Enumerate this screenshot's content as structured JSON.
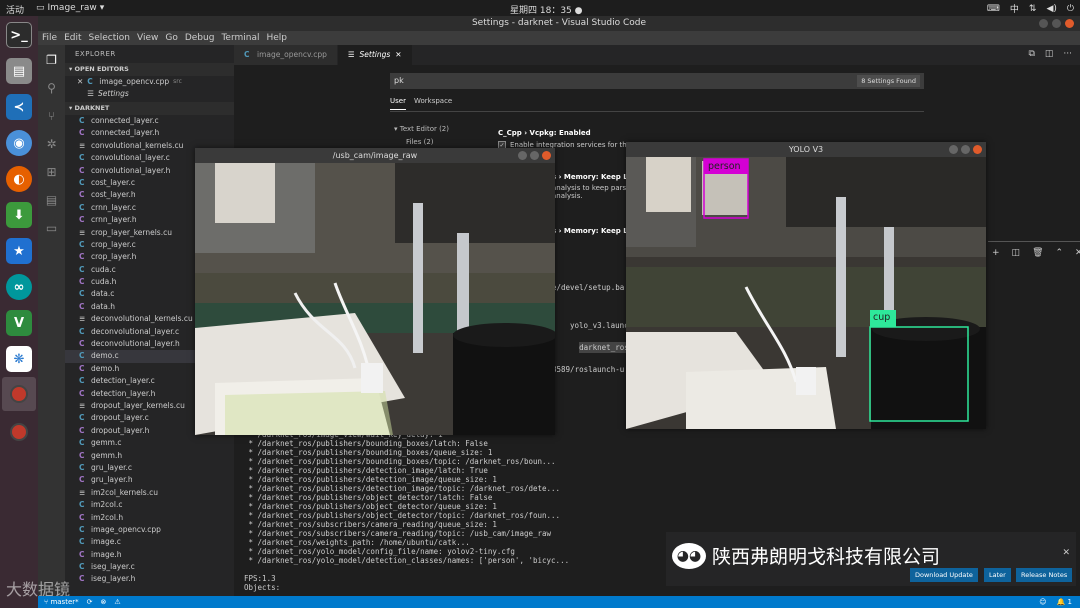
{
  "topbar": {
    "activities": "活动",
    "app_name": "Image_raw",
    "clock": "星期四 18：35",
    "lang": "中",
    "tray_icons": [
      "network-icon",
      "volume-icon",
      "power-icon"
    ]
  },
  "dock": {
    "items": [
      "terminal-icon",
      "files-icon",
      "vscode-icon",
      "chrome-icon",
      "firefox-icon",
      "download-icon",
      "star-icon",
      "arduino-icon",
      "v5-icon",
      "network-app-icon",
      "image-window-icon",
      "image-window-icon-2"
    ]
  },
  "vscode": {
    "title": "Settings - darknet - Visual Studio Code",
    "menu": [
      "File",
      "Edit",
      "Selection",
      "View",
      "Go",
      "Debug",
      "Terminal",
      "Help"
    ],
    "explorer_title": "EXPLORER",
    "open_editors_title": "OPEN EDITORS",
    "open_editors": [
      {
        "name": "image_opencv.cpp",
        "suffix": "src"
      },
      {
        "name": "Settings",
        "suffix": ""
      }
    ],
    "folder_title": "DARKNET",
    "files": [
      {
        "name": "connected_layer.c",
        "icon": "C"
      },
      {
        "name": "connected_layer.h",
        "icon": "C"
      },
      {
        "name": "convolutional_kernels.cu",
        "icon": "≡"
      },
      {
        "name": "convolutional_layer.c",
        "icon": "C"
      },
      {
        "name": "convolutional_layer.h",
        "icon": "C"
      },
      {
        "name": "cost_layer.c",
        "icon": "C"
      },
      {
        "name": "cost_layer.h",
        "icon": "C"
      },
      {
        "name": "crnn_layer.c",
        "icon": "C"
      },
      {
        "name": "crnn_layer.h",
        "icon": "C"
      },
      {
        "name": "crop_layer_kernels.cu",
        "icon": "≡"
      },
      {
        "name": "crop_layer.c",
        "icon": "C"
      },
      {
        "name": "crop_layer.h",
        "icon": "C"
      },
      {
        "name": "cuda.c",
        "icon": "C"
      },
      {
        "name": "cuda.h",
        "icon": "C"
      },
      {
        "name": "data.c",
        "icon": "C"
      },
      {
        "name": "data.h",
        "icon": "C"
      },
      {
        "name": "deconvolutional_kernels.cu",
        "icon": "≡"
      },
      {
        "name": "deconvolutional_layer.c",
        "icon": "C"
      },
      {
        "name": "deconvolutional_layer.h",
        "icon": "C"
      },
      {
        "name": "demo.c",
        "icon": "C"
      },
      {
        "name": "demo.h",
        "icon": "C"
      },
      {
        "name": "detection_layer.c",
        "icon": "C"
      },
      {
        "name": "detection_layer.h",
        "icon": "C"
      },
      {
        "name": "dropout_layer_kernels.cu",
        "icon": "≡"
      },
      {
        "name": "dropout_layer.c",
        "icon": "C"
      },
      {
        "name": "dropout_layer.h",
        "icon": "C"
      },
      {
        "name": "gemm.c",
        "icon": "C"
      },
      {
        "name": "gemm.h",
        "icon": "C"
      },
      {
        "name": "gru_layer.c",
        "icon": "C"
      },
      {
        "name": "gru_layer.h",
        "icon": "C"
      },
      {
        "name": "im2col_kernels.cu",
        "icon": "≡"
      },
      {
        "name": "im2col.c",
        "icon": "C"
      },
      {
        "name": "im2col.h",
        "icon": "C"
      },
      {
        "name": "image_opencv.cpp",
        "icon": "C"
      },
      {
        "name": "image.c",
        "icon": "C"
      },
      {
        "name": "image.h",
        "icon": "C"
      },
      {
        "name": "iseg_layer.c",
        "icon": "C"
      },
      {
        "name": "iseg_layer.h",
        "icon": "C"
      }
    ],
    "selected_file": "demo.c",
    "tabs": [
      {
        "label": "image_opencv.cpp",
        "active": false
      },
      {
        "label": "Settings",
        "active": true
      }
    ],
    "settings": {
      "search_value": "pk",
      "found_count": "8 Settings Found",
      "scopes": [
        "User",
        "Workspace"
      ],
      "tree": [
        "Text Editor (2)",
        "Files (2)"
      ],
      "entry1_title": "C_Cpp › Vcpkg: Enabled",
      "entry1_desc": "Enable integration services for the",
      "entry2_title": "s › Memory: Keep Lib",
      "entry2_desc1": "analysis to keep parse",
      "entry2_desc2": "analysis.",
      "entry3_title": "s › Memory: Keep Lib",
      "term_line1": "e/devel/setup.ba",
      "term_line2": "yolo_v3.launc",
      "term_line3": "darknet_ros.launch",
      "term_line4": "8589/roslaunch-u"
    },
    "terminal_lines": [
      " * /darknet_ros/image_view/wait_key_delay: 1",
      " * /darknet_ros/publishers/bounding_boxes/latch: False",
      " * /darknet_ros/publishers/bounding_boxes/queue_size: 1",
      " * /darknet_ros/publishers/bounding_boxes/topic: /darknet_ros/boun...",
      " * /darknet_ros/publishers/detection_image/latch: True",
      " * /darknet_ros/publishers/detection_image/queue_size: 1",
      " * /darknet_ros/publishers/detection_image/topic: /darknet_ros/dete...",
      " * /darknet_ros/publishers/object_detector/latch: False",
      " * /darknet_ros/publishers/object_detector/queue_size: 1",
      " * /darknet_ros/publishers/object_detector/topic: /darknet_ros/foun...",
      " * /darknet_ros/subscribers/camera_reading/queue_size: 1",
      " * /darknet_ros/subscribers/camera_reading/topic: /usb_cam/image_raw",
      " * /darknet_ros/weights_path: /home/ubuntu/catk...",
      " * /darknet_ros/yolo_model/config_file/name: yolov2-tiny.cfg",
      " * /darknet_ros/yolo_model/detection_classes/names: ['person', 'bicyc...",
      "",
      "FPS:1.3",
      "Objects:"
    ],
    "notification": {
      "brand": "陕西弗朗明戈科技有限公司",
      "download_label": "Download Update",
      "later_label": "Later",
      "release_notes_label": "Release Notes"
    },
    "status": {
      "branch": "master*",
      "left_icons": [
        "sync-icon",
        "error-icon",
        "warning-icon"
      ],
      "right": [
        "☺",
        "🔔 1"
      ]
    }
  },
  "windows": {
    "raw_title": "/usb_cam/image_raw",
    "yolo_title": "YOLO V3",
    "detections": [
      {
        "label": "person",
        "color": "#d400d4"
      },
      {
        "label": "cup",
        "color": "#2ee89a"
      }
    ]
  },
  "watermark": "大数据镜"
}
